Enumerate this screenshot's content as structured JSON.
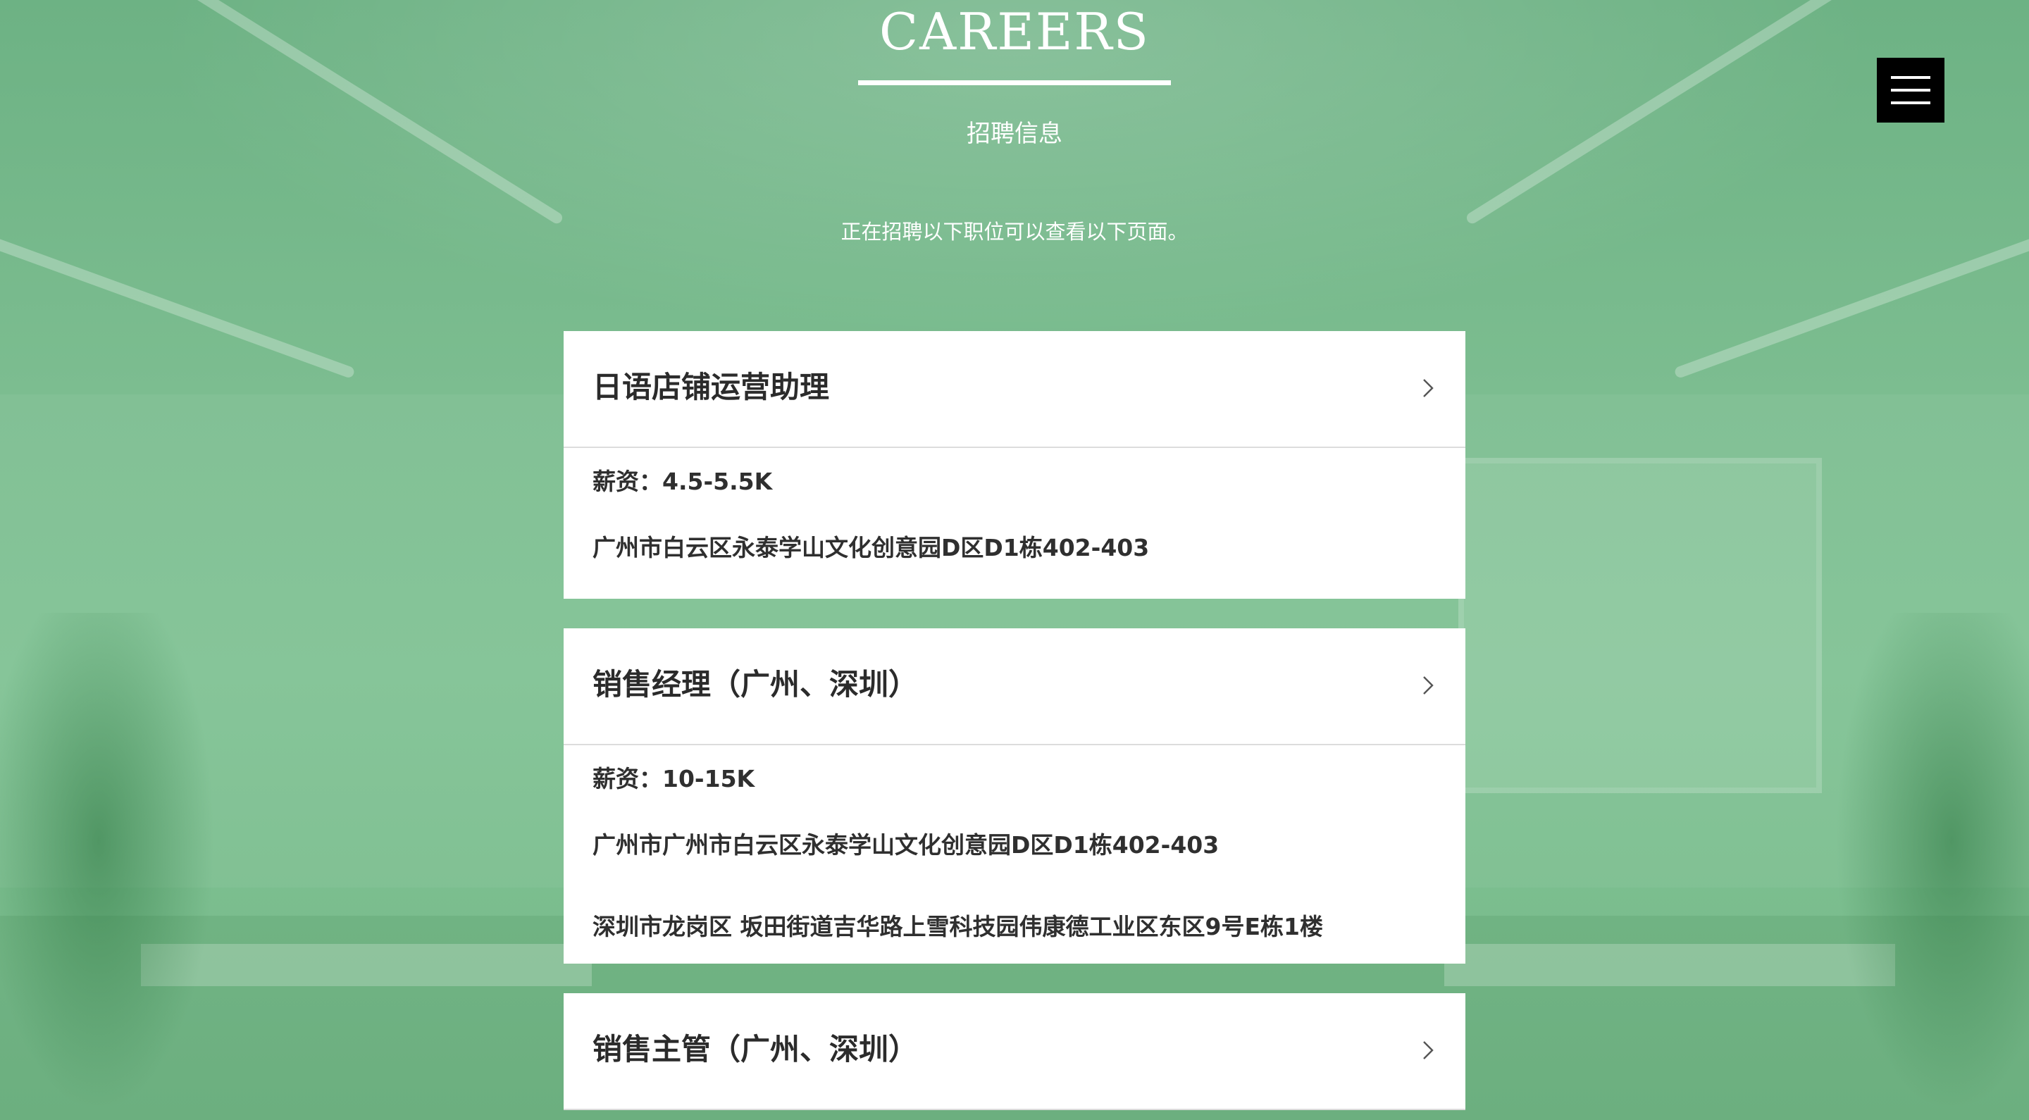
{
  "header": {
    "title": "CAREERS",
    "subtitle": "招聘信息",
    "intro": "正在招聘以下职位可以查看以下页面。"
  },
  "menu": {
    "icon": "hamburger-menu-icon"
  },
  "colors": {
    "background_overlay": "#79b88c",
    "card": "#ffffff",
    "text": "#2b2b2b",
    "menu_button": "#000000"
  },
  "jobs": [
    {
      "title": "日语店铺运营助理",
      "salary": "薪资：4.5-5.5K",
      "addresses": [
        "广州市白云区永泰学山文化创意园D区D1栋402-403"
      ]
    },
    {
      "title": "销售经理（广州、深圳）",
      "salary": "薪资：10-15K",
      "addresses": [
        "广州市广州市白云区永泰学山文化创意园D区D1栋402-403",
        "深圳市龙岗区 坂田街道吉华路上雪科技园伟康德工业区东区9号E栋1楼"
      ]
    },
    {
      "title": "销售主管（广州、深圳）"
    }
  ]
}
